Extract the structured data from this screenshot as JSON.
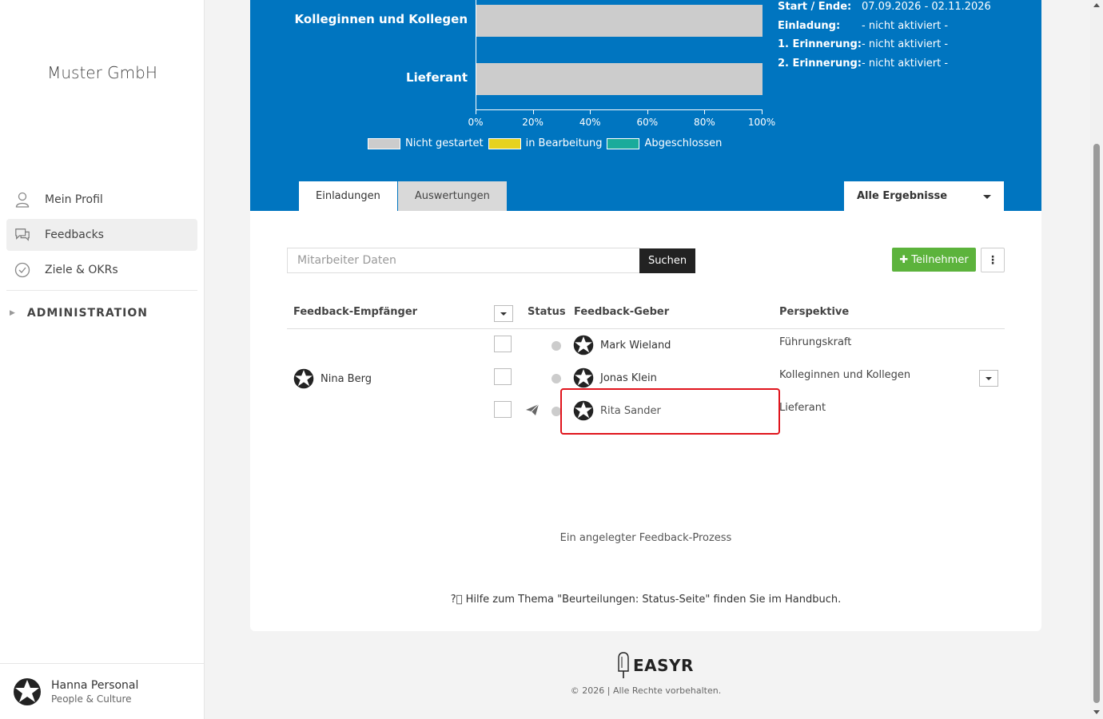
{
  "sidebar": {
    "company": "Muster GmbH",
    "items": [
      {
        "label": "Mein Profil",
        "icon": "user-icon"
      },
      {
        "label": "Feedbacks",
        "icon": "chat-icon",
        "active": true
      },
      {
        "label": "Ziele & OKRs",
        "icon": "check-circle-icon"
      }
    ],
    "admin_label": "ADMINISTRATION",
    "user": {
      "name": "Hanna Personal",
      "role": "People & Culture"
    }
  },
  "chart_data": {
    "type": "bar",
    "orientation": "horizontal",
    "stacked": true,
    "categories": [
      "Kolleginnen und Kollegen",
      "Lieferant"
    ],
    "series": [
      {
        "name": "Nicht gestartet",
        "color": "#cccccc",
        "values": [
          100,
          100
        ]
      },
      {
        "name": "in Bearbeitung",
        "color": "#e6d21e",
        "values": [
          0,
          0
        ]
      },
      {
        "name": "Abgeschlossen",
        "color": "#1aab9b",
        "values": [
          0,
          0
        ]
      }
    ],
    "xticks": [
      "0%",
      "20%",
      "40%",
      "60%",
      "80%",
      "100%"
    ],
    "xlim": [
      0,
      100
    ]
  },
  "meta": {
    "rows": [
      {
        "key": "Start / Ende:",
        "value": "07.09.2026 - 02.11.2026"
      },
      {
        "key": "Einladung:",
        "value": "- nicht aktiviert -"
      },
      {
        "key": "1. Erinnerung:",
        "value": "- nicht aktiviert -"
      },
      {
        "key": "2. Erinnerung:",
        "value": "- nicht aktiviert -"
      }
    ]
  },
  "tabs": [
    {
      "label": "Einladungen",
      "active": true
    },
    {
      "label": "Auswertungen",
      "active": false
    }
  ],
  "filter": {
    "selected": "Alle Ergebnisse"
  },
  "toolbar": {
    "search_placeholder": "Mitarbeiter Daten",
    "search_button": "Suchen",
    "add_button": "Teilnehmer"
  },
  "table": {
    "headers": {
      "recipient": "Feedback-Empfänger",
      "status": "Status",
      "giver": "Feedback-Geber",
      "perspective": "Perspektive"
    },
    "recipient": "Nina Berg",
    "rows": [
      {
        "giver": "Mark Wieland",
        "perspective": "Führungskraft",
        "sent_icon": false
      },
      {
        "giver": "Jonas Klein",
        "perspective": "Kolleginnen und Kollegen",
        "sent_icon": false
      },
      {
        "giver": "Rita Sander",
        "perspective": "Lieferant",
        "sent_icon": true
      }
    ]
  },
  "summary": "Ein angelegter Feedback-Prozess",
  "help_text": "Hilfe zum Thema \"Beurteilungen: Status-Seite\" finden Sie im Handbuch.",
  "footer": {
    "logo": "EASYR",
    "copyright": "© 2026 | Alle Rechte vorbehalten."
  }
}
